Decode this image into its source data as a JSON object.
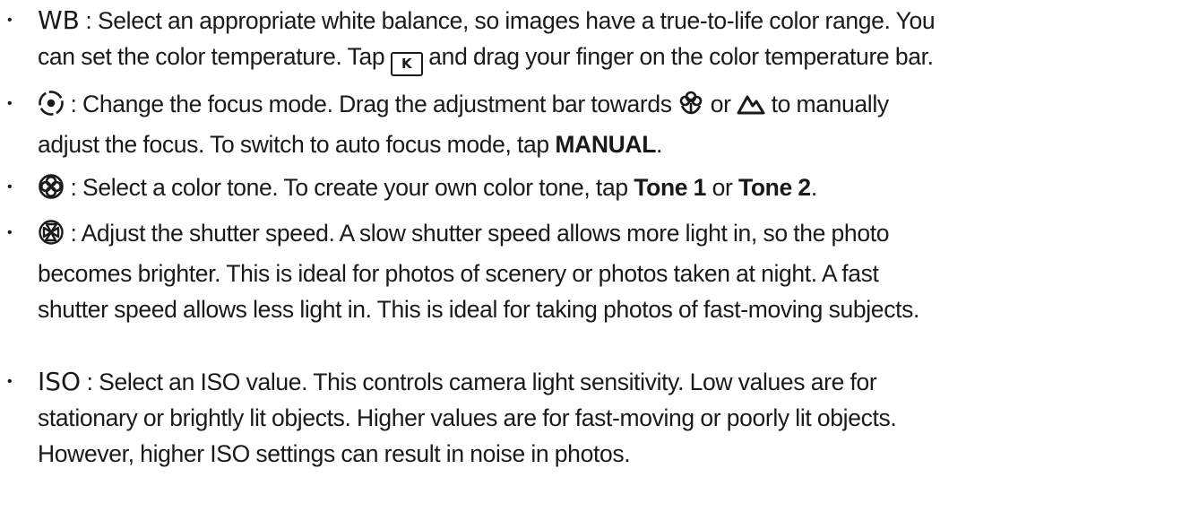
{
  "bullet_glyph": "•",
  "items": [
    {
      "icon": "wb-label",
      "label": "WB",
      "line1_a": " : Select an appropriate white balance, so images have a true-to-life color range. You",
      "line2_a": "can set the color temperature. Tap ",
      "key_icon": "K",
      "line2_b": " and drag your finger on the color temperature bar."
    },
    {
      "icon": "focus-icon",
      "line1_a": " : Change the focus mode. Drag the adjustment bar towards ",
      "macro_icon": "macro-flower-icon",
      "line1_b": " or ",
      "mountain_icon": "mountain-icon",
      "line1_c": " to manually",
      "line2_a": "adjust the focus. To switch to auto focus mode, tap ",
      "bold": "MANUAL",
      "line2_b": "."
    },
    {
      "icon": "color-tone-icon",
      "line1_a": " : Select a color tone. To create your own color tone, tap ",
      "bold1": "Tone 1",
      "mid": " or ",
      "bold2": "Tone 2",
      "end": "."
    },
    {
      "icon": "shutter-icon",
      "line1": " : Adjust the shutter speed. A slow shutter speed allows more light in, so the photo",
      "line2": "becomes brighter. This is ideal for photos of scenery or photos taken at night. A fast",
      "line3": "shutter speed allows less light in. This is ideal for taking photos of fast-moving subjects."
    },
    {
      "icon": "iso-label",
      "label": "ISO",
      "line1": " : Select an ISO value. This controls camera light sensitivity. Low values are for",
      "line2": "stationary or brightly lit objects. Higher values are for fast-moving or poorly lit objects.",
      "line3": "However, higher ISO settings can result in noise in photos."
    }
  ]
}
